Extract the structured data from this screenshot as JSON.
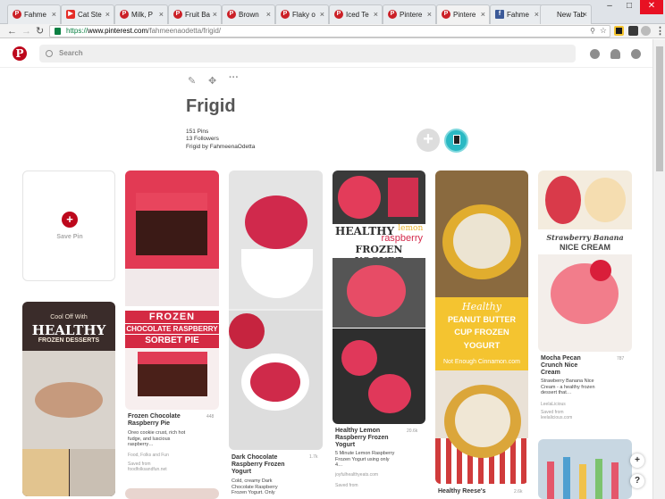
{
  "browser": {
    "tabs": [
      {
        "label": "Fahme",
        "icon": "pinterest-icon"
      },
      {
        "label": "Cat Ste",
        "icon": "youtube-icon"
      },
      {
        "label": "Milk, P",
        "icon": "pinterest-icon"
      },
      {
        "label": "Fruit Ba",
        "icon": "pinterest-icon"
      },
      {
        "label": "Brown",
        "icon": "pinterest-icon"
      },
      {
        "label": "Flaky o",
        "icon": "pinterest-icon"
      },
      {
        "label": "Iced Te",
        "icon": "pinterest-icon"
      },
      {
        "label": "Pintere",
        "icon": "pinterest-icon"
      },
      {
        "label": "Pintere",
        "icon": "pinterest-icon"
      },
      {
        "label": "Fahme",
        "icon": "facebook-icon"
      },
      {
        "label": "New Tab",
        "icon": "none"
      }
    ],
    "active_tab": 8,
    "url_scheme": "https://",
    "url_host": "www.pinterest.com",
    "url_path": "/fahmeenaodetta/frigid/"
  },
  "header": {
    "search_placeholder": "Search"
  },
  "board": {
    "title": "Frigid",
    "pins_count": "151 Pins",
    "followers": "13 Followers",
    "owner_line": "Frigid by FahmeenaOdetta",
    "save_pin_label": "Save Pin"
  },
  "pins": {
    "cooloff": {
      "line1": "Cool Off With",
      "line2": "HEALTHY",
      "line3": "FROZEN DESSERTS"
    },
    "sorbet": {
      "band1": "FROZEN",
      "band2": "CHOCOLATE RASPBERRY",
      "band3": "SORBET PIE",
      "title": "Frozen Chocolate Raspberry Pie",
      "count": "448",
      "desc": "Oreo cookie crust, rich hot fudge, and luscious raspberry…",
      "board": "Food, Folks and Fun",
      "saved": "Saved from",
      "source": "foodfolksandfun.net"
    },
    "darkchoc": {
      "title": "Dark Chocolate Raspberry Frozen Yogurt",
      "count": "1.7k",
      "desc": "Cold, creamy Dark Chocolate Raspberry Frozen Yogurt. Only"
    },
    "lemon": {
      "band1": "HEALTHY",
      "band1b": "lemon",
      "band2": "raspberry",
      "band3": "FROZEN YOGURT",
      "title": "Healthy Lemon Raspberry Frozen Yogurt",
      "count": "20.6k",
      "desc": "5 Minute Lemon Raspberry Frozen Yogurt using only 4…",
      "source": "joyfulhealthyeats.com",
      "saved": "Saved from"
    },
    "peanut": {
      "band1": "Healthy",
      "band2": "PEANUT BUTTER",
      "band3": "CUP FROZEN",
      "band4": "YOGURT",
      "band5": "Not Enough Cinnamon.com",
      "title": "Healthy Reese's",
      "count": "2.6k"
    },
    "mocha": {
      "band1": "Strawberry Banana",
      "band2": "NICE CREAM",
      "title": "Mocha Pecan Crunch Nice Cream",
      "count": "787",
      "desc": "Strawberry Banana Nice Cream - a healthy frozen dessert that…",
      "board": "LeelaLicious",
      "saved": "Saved from",
      "source": "leelalicious.com"
    }
  },
  "colors": {
    "pinterest_red": "#bd081c",
    "raspberry": "#d7264a",
    "yellow_band": "#f4c430"
  }
}
